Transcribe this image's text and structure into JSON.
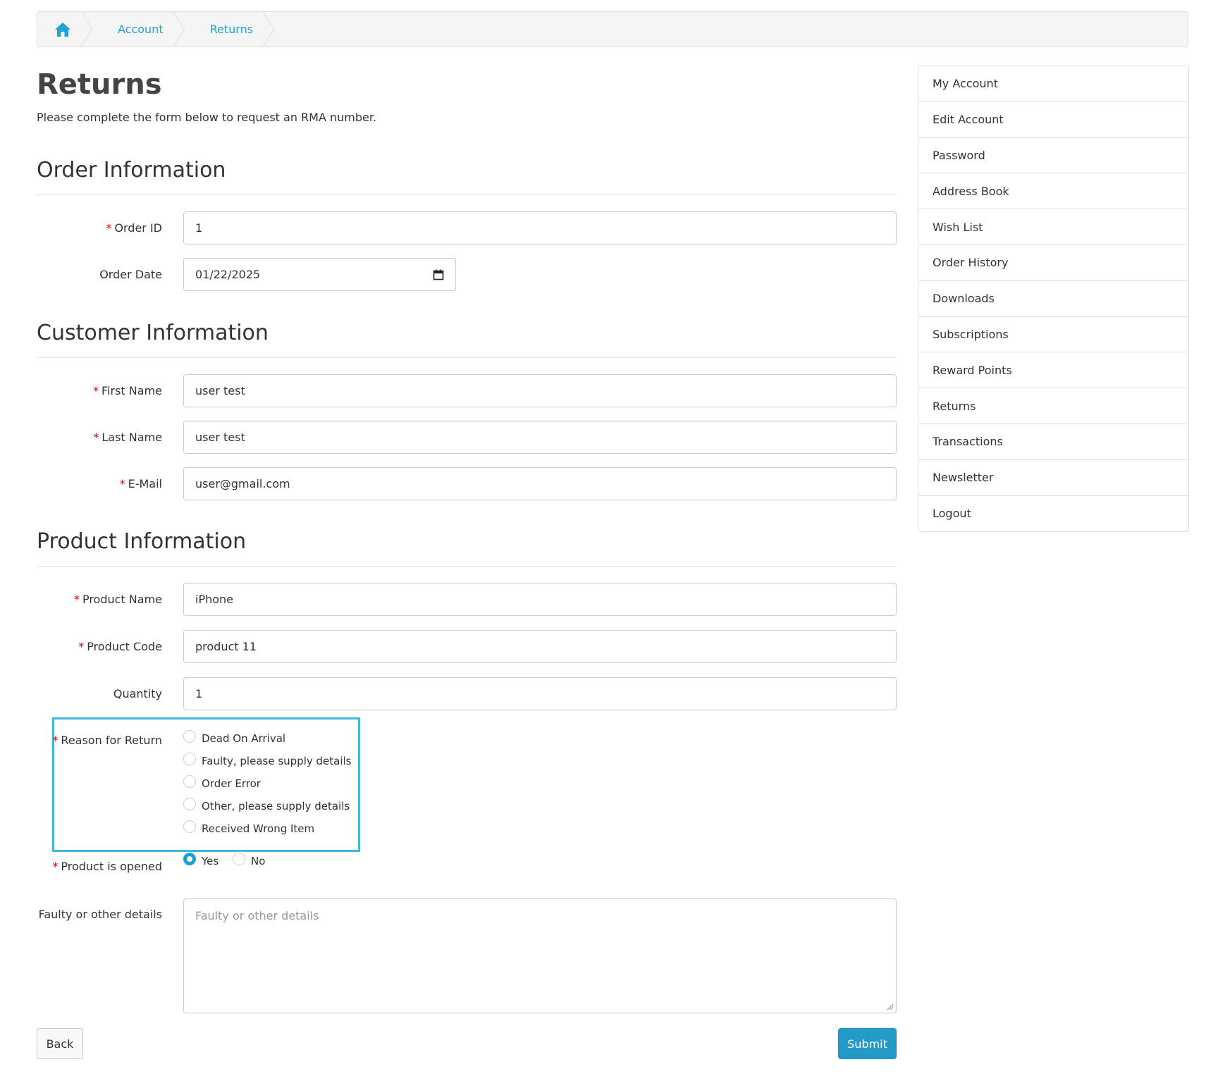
{
  "breadcrumb": {
    "home_icon": "home-icon",
    "items": [
      "Account",
      "Returns"
    ]
  },
  "page": {
    "title": "Returns",
    "intro": "Please complete the form below to request an RMA number."
  },
  "order_section": {
    "title": "Order Information",
    "order_id_label": "Order ID",
    "order_id_value": "1",
    "order_date_label": "Order Date",
    "order_date_value": "01/22/2025"
  },
  "customer_section": {
    "title": "Customer Information",
    "first_name_label": "First Name",
    "first_name_value": "user test",
    "last_name_label": "Last Name",
    "last_name_value": "user test",
    "email_label": "E-Mail",
    "email_value": "user@gmail.com"
  },
  "product_section": {
    "title": "Product Information",
    "product_name_label": "Product Name",
    "product_name_value": "iPhone",
    "product_code_label": "Product Code",
    "product_code_value": "product 11",
    "quantity_label": "Quantity",
    "quantity_value": "1",
    "reason_label": "Reason for Return",
    "reasons": [
      "Dead On Arrival",
      "Faulty, please supply details",
      "Order Error",
      "Other, please supply details",
      "Received Wrong Item"
    ],
    "opened_label": "Product is opened",
    "opened_yes": "Yes",
    "opened_no": "No",
    "opened_selected": "Yes",
    "details_label": "Faulty or other details",
    "details_placeholder": "Faulty or other details"
  },
  "buttons": {
    "back": "Back",
    "submit": "Submit"
  },
  "sidebar": {
    "items": [
      "My Account",
      "Edit Account",
      "Password",
      "Address Book",
      "Wish List",
      "Order History",
      "Downloads",
      "Subscriptions",
      "Reward Points",
      "Returns",
      "Transactions",
      "Newsletter",
      "Logout"
    ]
  },
  "colors": {
    "link": "#23a1d1",
    "primary": "#229ac8",
    "required": "#e00000",
    "highlight": "#41b9dd"
  }
}
